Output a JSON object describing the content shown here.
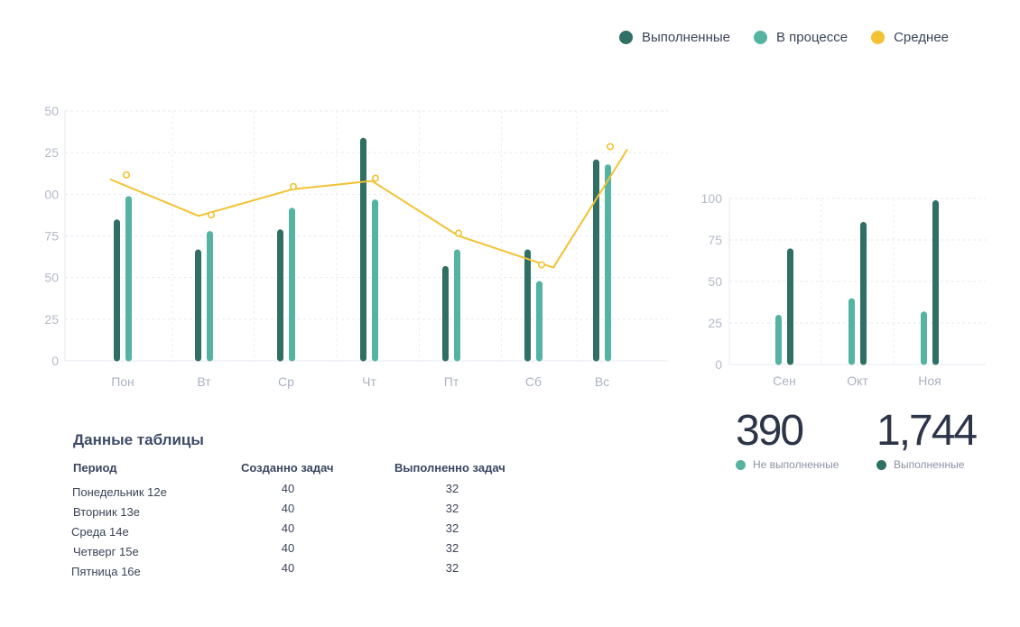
{
  "legend": {
    "items": [
      {
        "label": "Выполненные",
        "color": "#2f6f64"
      },
      {
        "label": "В процессе",
        "color": "#55b3a2"
      },
      {
        "label": "Среднее",
        "color": "#f2c232"
      }
    ]
  },
  "chart_data": [
    {
      "type": "bar",
      "categories": [
        "Пон",
        "Вт",
        "Ср",
        "Чт",
        "Пт",
        "Сб",
        "Вс"
      ],
      "y_tick_labels": [
        "0",
        "25",
        "50",
        "75",
        "00",
        "25",
        "50"
      ],
      "ylim": [
        0,
        150
      ],
      "grid": true,
      "series": [
        {
          "name": "Выполненные",
          "type": "bar",
          "color": "#2f6f64",
          "values": [
            83,
            65,
            77,
            132,
            55,
            65,
            119
          ]
        },
        {
          "name": "В процессе",
          "type": "bar",
          "color": "#55b3a2",
          "values": [
            97,
            76,
            90,
            95,
            65,
            46,
            116
          ]
        },
        {
          "name": "Среднее",
          "type": "line",
          "color": "#f2c232",
          "values": [
            109,
            87,
            103,
            108,
            75,
            56,
            127
          ]
        }
      ],
      "average_markers": [
        110,
        86,
        103,
        108,
        75,
        56,
        127
      ]
    },
    {
      "type": "bar",
      "categories": [
        "Сен",
        "Окт",
        "Ноя"
      ],
      "y_tick_labels": [
        "0",
        "25",
        "50",
        "75",
        "100"
      ],
      "ylim": [
        0,
        100
      ],
      "grid": true,
      "series": [
        {
          "name": "В процессе",
          "color": "#55b3a2",
          "values": [
            28,
            38,
            30
          ]
        },
        {
          "name": "Выполненные",
          "color": "#2f6f64",
          "values": [
            68,
            84,
            97
          ]
        }
      ]
    }
  ],
  "stats": [
    {
      "value": "390",
      "label": "Не выполненные",
      "color": "#55b3a2"
    },
    {
      "value": "1,744",
      "label": "Выполненные",
      "color": "#2f6f64"
    }
  ],
  "table": {
    "title": "Данные таблицы",
    "headers": [
      "Период",
      "Созданно задач",
      "Выполненно задач"
    ],
    "rows": [
      [
        "Понедельник 12е",
        "40",
        "32"
      ],
      [
        "Вторник 13е",
        "40",
        "32"
      ],
      [
        "Среда 14е",
        "40",
        "32"
      ],
      [
        "Четверг 15е",
        "40",
        "32"
      ],
      [
        "Пятница 16е",
        "40",
        "32"
      ]
    ]
  }
}
